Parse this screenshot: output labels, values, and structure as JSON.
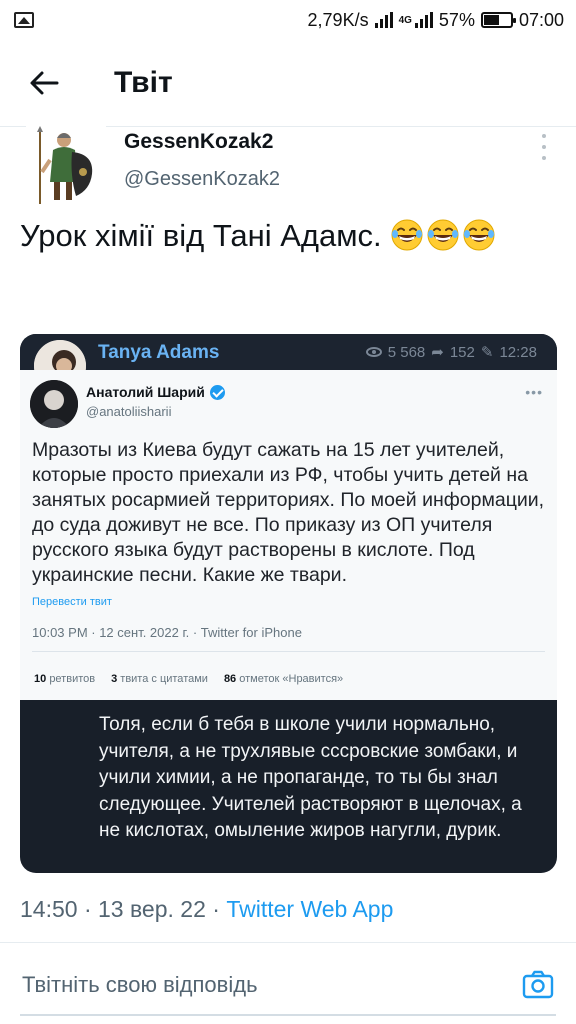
{
  "status_bar": {
    "net_speed": "2,79K/s",
    "network": "4G",
    "battery": "57%",
    "battery_level": 0.57,
    "time": "07:00"
  },
  "header": {
    "title": "Твіт"
  },
  "tweet": {
    "author_name": "GessenKozak2",
    "author_handle": "@GessenKozak2",
    "text": "Урок хімії від Тані Адамс.",
    "emoji": "grinning-face-with-tears-icon",
    "emoji_count": 3,
    "timestamp": "14:50 · 13 вер. 22 · ",
    "source": "Twitter Web App"
  },
  "media": {
    "channel_name": "Tanya Adams",
    "views": "5 568",
    "shares": "152",
    "time": "12:28",
    "embedded_tweet": {
      "name": "Анатолий Шарий",
      "handle": "@anatoliisharii",
      "body": "Мразоты из Киева будут сажать на 15 лет учителей, которые просто приехали из РФ, чтобы учить детей на занятых росармией территориях. По моей информации, до суда доживут не все. По приказу из ОП учителя русского языка будут растворены в кислоте. Под украинские песни. Какие же твари.",
      "translate": "Перевести твит",
      "time": "10:03 PM · 12 сент. 2022 г. · Twitter for iPhone",
      "retweets_count": "10",
      "retweets_label": "ретвитов",
      "quotes_count": "3",
      "quotes_label": "твита с цитатами",
      "likes_count": "86",
      "likes_label": "отметок «Нравится»"
    },
    "reply_text": "Толя, если б тебя в школе учили нормально, учителя, а не трухлявые сссровские зомбаки, и учили химии, а не пропаганде, то ты бы знал следующее. Учителей растворяют в щелочах, а не кислотах, омыление жиров нагугли, дурик."
  },
  "reply": {
    "placeholder": "Твітніть свою відповідь"
  },
  "colors": {
    "accent": "#1d9bf0",
    "telegram_bg": "#181f29",
    "telegram_name": "#6ab3f3"
  }
}
